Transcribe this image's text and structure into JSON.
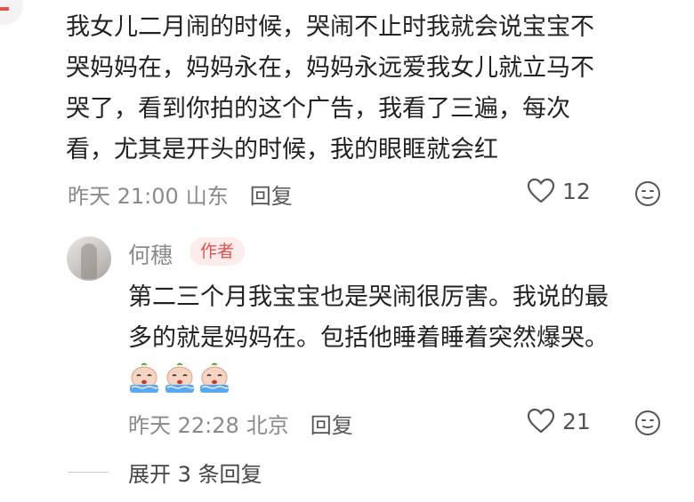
{
  "comment": {
    "text": "我女儿二月闹的时候，哭闹不止时我就会说宝宝不\n哭妈妈在，妈妈永在，妈妈永远爱我女儿就立马不\n哭了，看到你拍的这个广告，我看了三遍，每次\n看，尤其是开头的时候，我的眼眶就会红",
    "time": "昨天 21:00",
    "location": "山东",
    "reply_label": "回复",
    "likes": "12"
  },
  "reply": {
    "author": "何穗",
    "badge": "作者",
    "text": "第二三个月我宝宝也是哭闹很厉害。我说的最\n多的就是妈妈在。包括他睡着睡着突然爆哭。",
    "sticker_icons": [
      "crying-face-sticker",
      "crying-face-sticker",
      "crying-face-sticker"
    ],
    "time": "昨天 22:28",
    "location": "北京",
    "reply_label": "回复",
    "likes": "21"
  },
  "expand": {
    "label": "展开 3 条回复"
  },
  "colors": {
    "badge_bg": "#fdeceb",
    "badge_text": "#e0524c",
    "meta_gray": "#8a8a8a",
    "text_primary": "#222222"
  }
}
